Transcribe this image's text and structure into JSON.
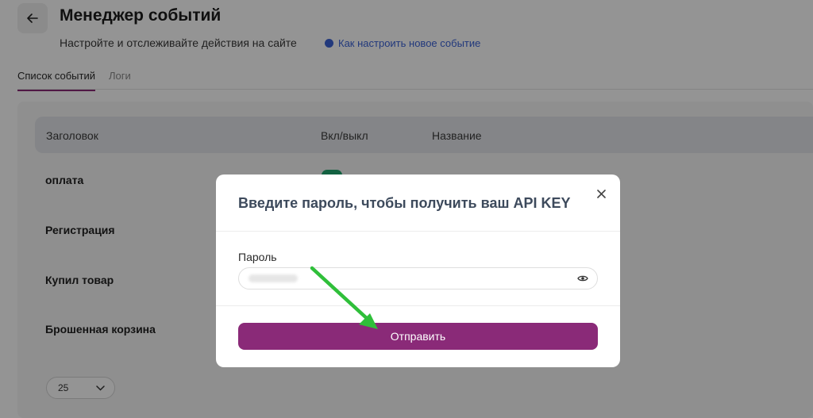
{
  "header": {
    "title": "Менеджер событий",
    "subtitle": "Настройте и отслеживайте действия на сайте",
    "help_link": "Как настроить новое событие"
  },
  "tabs": [
    {
      "label": "Список событий",
      "active": true
    },
    {
      "label": "Логи",
      "active": false
    }
  ],
  "table": {
    "columns": [
      "Заголовок",
      "Вкл/выкл",
      "Название"
    ],
    "rows": [
      {
        "title": "оплата",
        "enabled": true
      },
      {
        "title": "Регистрация"
      },
      {
        "title": "Купил товар"
      },
      {
        "title": "Брошенная корзина"
      }
    ]
  },
  "pagination": {
    "page_size": "25"
  },
  "modal": {
    "title": "Введите пароль, чтобы получить ваш API KEY",
    "password_label": "Пароль",
    "submit_label": "Отправить"
  },
  "colors": {
    "accent": "#8a2a78",
    "link": "#3b62d6",
    "toggle_on": "#21a870",
    "annotation_arrow": "#2fbf3a"
  },
  "icons": [
    "arrow-left-icon",
    "help-circle-icon",
    "chevron-down-icon",
    "close-icon",
    "eye-icon"
  ]
}
